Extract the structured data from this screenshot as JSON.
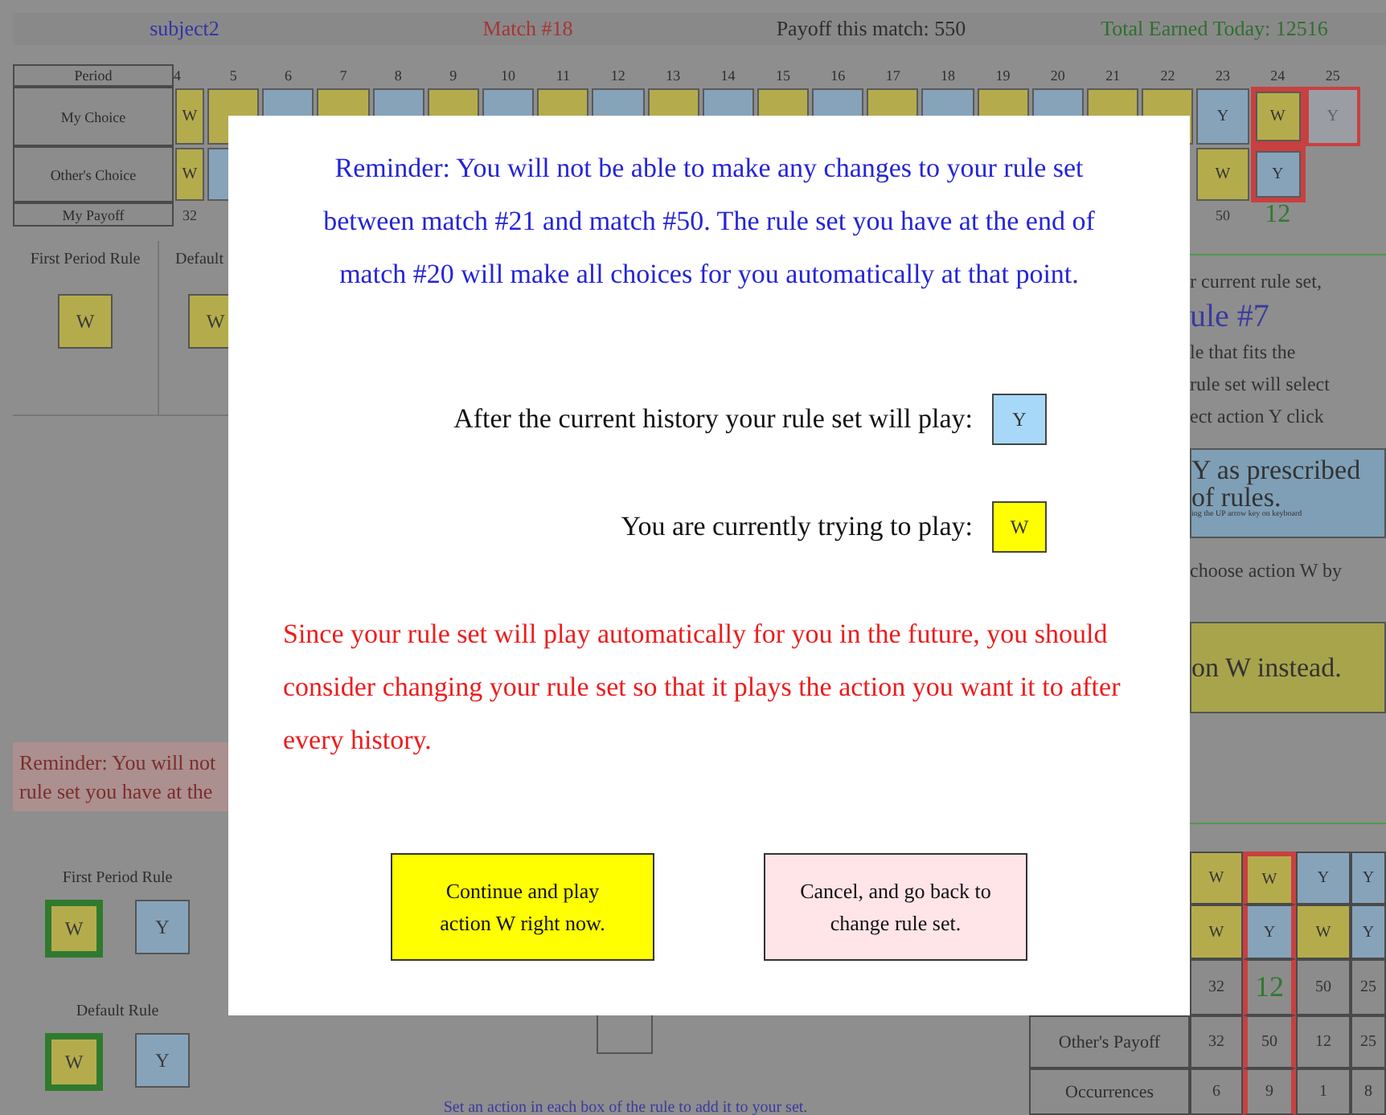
{
  "header": {
    "subject": "subject2",
    "match": "Match #18",
    "payoff": "Payoff this match: 550",
    "total": "Total Earned Today: 12516"
  },
  "history": {
    "row_labels": [
      "Period",
      "My Choice",
      "Other's Choice",
      "My Payoff"
    ],
    "periods": [
      {
        "period": "4",
        "mine": {
          "action": "W",
          "color": "#b4ac4c"
        },
        "other": {
          "action": "W",
          "color": "#b4ac4c"
        },
        "payoff": "32",
        "selected": false,
        "tentative": false
      },
      {
        "period": "5",
        "mine": {
          "color": "#b4ac4c"
        },
        "other": {
          "color": "#87a3ba"
        },
        "selected": false,
        "tentative": false
      },
      {
        "period": "6",
        "mine": {
          "color": "#87a3ba"
        },
        "selected": false,
        "tentative": false
      },
      {
        "period": "7",
        "mine": {
          "color": "#b4ac4c"
        },
        "selected": false,
        "tentative": false
      },
      {
        "period": "8",
        "mine": {
          "color": "#87a3ba"
        },
        "selected": false,
        "tentative": false
      },
      {
        "period": "9",
        "mine": {
          "color": "#b4ac4c"
        },
        "selected": false,
        "tentative": false
      },
      {
        "period": "10",
        "mine": {
          "color": "#87a3ba"
        },
        "selected": false,
        "tentative": false
      },
      {
        "period": "11",
        "mine": {
          "color": "#b4ac4c"
        },
        "selected": false,
        "tentative": false
      },
      {
        "period": "12",
        "mine": {
          "color": "#87a3ba"
        },
        "selected": false,
        "tentative": false
      },
      {
        "period": "13",
        "mine": {
          "color": "#b4ac4c"
        },
        "selected": false,
        "tentative": false
      },
      {
        "period": "14",
        "mine": {
          "color": "#87a3ba"
        },
        "selected": false,
        "tentative": false
      },
      {
        "period": "15",
        "mine": {
          "color": "#b4ac4c"
        },
        "selected": false,
        "tentative": false
      },
      {
        "period": "16",
        "mine": {
          "color": "#87a3ba"
        },
        "selected": false,
        "tentative": false
      },
      {
        "period": "17",
        "mine": {
          "color": "#b4ac4c"
        },
        "selected": false,
        "tentative": false
      },
      {
        "period": "18",
        "mine": {
          "color": "#87a3ba"
        },
        "selected": false,
        "tentative": false
      },
      {
        "period": "19",
        "mine": {
          "color": "#b4ac4c"
        },
        "selected": false,
        "tentative": false
      },
      {
        "period": "20",
        "mine": {
          "color": "#87a3ba"
        },
        "selected": false,
        "tentative": false
      },
      {
        "period": "21",
        "mine": {
          "color": "#b4ac4c"
        },
        "selected": false,
        "tentative": false
      },
      {
        "period": "22",
        "mine": {
          "color": "#b4ac4c"
        },
        "selected": false,
        "tentative": false
      },
      {
        "period": "23",
        "mine": {
          "action": "Y",
          "color": "#87a3ba"
        },
        "other": {
          "action": "W",
          "color": "#b4ac4c"
        },
        "payoff": "50",
        "selected": false,
        "tentative": false
      },
      {
        "period": "24",
        "mine": {
          "action": "W",
          "color": "#b4ac4c"
        },
        "other": {
          "action": "Y",
          "color": "#87a3ba"
        },
        "payoff": "12",
        "selected": true,
        "tentative": false
      },
      {
        "period": "25",
        "mine": {
          "action": "Y",
          "color": "#9a9ea4"
        },
        "selected": false,
        "tentative": true
      }
    ]
  },
  "top_rules": [
    {
      "label": "First Period Rule",
      "action": "W",
      "color": "#b4ac4c"
    },
    {
      "label": "Default",
      "action": "W",
      "color": "#b4ac4c"
    }
  ],
  "reminder_strip": [
    "Reminder: You will not",
    "rule set you have at the"
  ],
  "rule_panel": {
    "intro": "r current rule set,",
    "rule_name": "ule #7",
    "lines": [
      "le that fits the",
      "rule set will select",
      "ect action Y click"
    ],
    "prescribed_button": {
      "lines": [
        "Y as prescribed",
        "of rules."
      ],
      "hint": "ing the UP arrow key on keyboard"
    },
    "choose_text": "choose action W by",
    "instead_button": "on W instead."
  },
  "rule_editor": {
    "rules": [
      {
        "label": "First Period Rule",
        "options": [
          {
            "action": "W",
            "color": "#b4ac4c",
            "selected": true
          },
          {
            "action": "Y",
            "color": "#87a3ba",
            "selected": false
          }
        ]
      },
      {
        "label": "Default Rule",
        "options": [
          {
            "action": "W",
            "color": "#b4ac4c",
            "selected": true
          },
          {
            "action": "Y",
            "color": "#87a3ba",
            "selected": false
          }
        ]
      }
    ],
    "instruction": "Set an action in each box of the rule to add it to your set."
  },
  "outcomes": {
    "labels": [
      "Other's Payoff",
      "Occurrences"
    ],
    "columns": [
      {
        "mine": {
          "action": "W",
          "color": "#b4ac4c"
        },
        "other": {
          "action": "W",
          "color": "#b4ac4c"
        },
        "my_payoff": "32",
        "other_payoff": "32",
        "occurrences": "6",
        "selected": false
      },
      {
        "mine": {
          "action": "W",
          "color": "#b4ac4c"
        },
        "other": {
          "action": "Y",
          "color": "#87a3ba"
        },
        "my_payoff": "12",
        "other_payoff": "50",
        "occurrences": "9",
        "selected": true
      },
      {
        "mine": {
          "action": "Y",
          "color": "#87a3ba"
        },
        "other": {
          "action": "W",
          "color": "#b4ac4c"
        },
        "my_payoff": "50",
        "other_payoff": "12",
        "occurrences": "1",
        "selected": false
      },
      {
        "mine": {
          "action": "Y",
          "color": "#87a3ba"
        },
        "other": {
          "action": "Y",
          "color": "#87a3ba"
        },
        "my_payoff": "25",
        "other_payoff": "25",
        "occurrences": "8",
        "selected": false
      }
    ]
  },
  "modal": {
    "reminder": "Reminder: You will not be able to make any changes to your rule set between match #21 and match #50. The rule set you have at the end of match #20 will make all choices for you automatically at that point.",
    "plays": [
      {
        "label": "After the current history your rule set will play:",
        "action": "Y",
        "color": "#a8d8f8"
      },
      {
        "label": "You are currently trying to play:",
        "action": "W",
        "color": "#ffff00"
      }
    ],
    "warning": "Since your rule set will play automatically for you in the future, you should consider changing your rule set so that it plays the action you want it to after every history.",
    "buttons": [
      {
        "kind": "continue",
        "lines": [
          "Continue and play",
          "action W right now."
        ]
      },
      {
        "kind": "cancel",
        "lines": [
          "Cancel, and go back to",
          "change rule set."
        ]
      }
    ]
  }
}
